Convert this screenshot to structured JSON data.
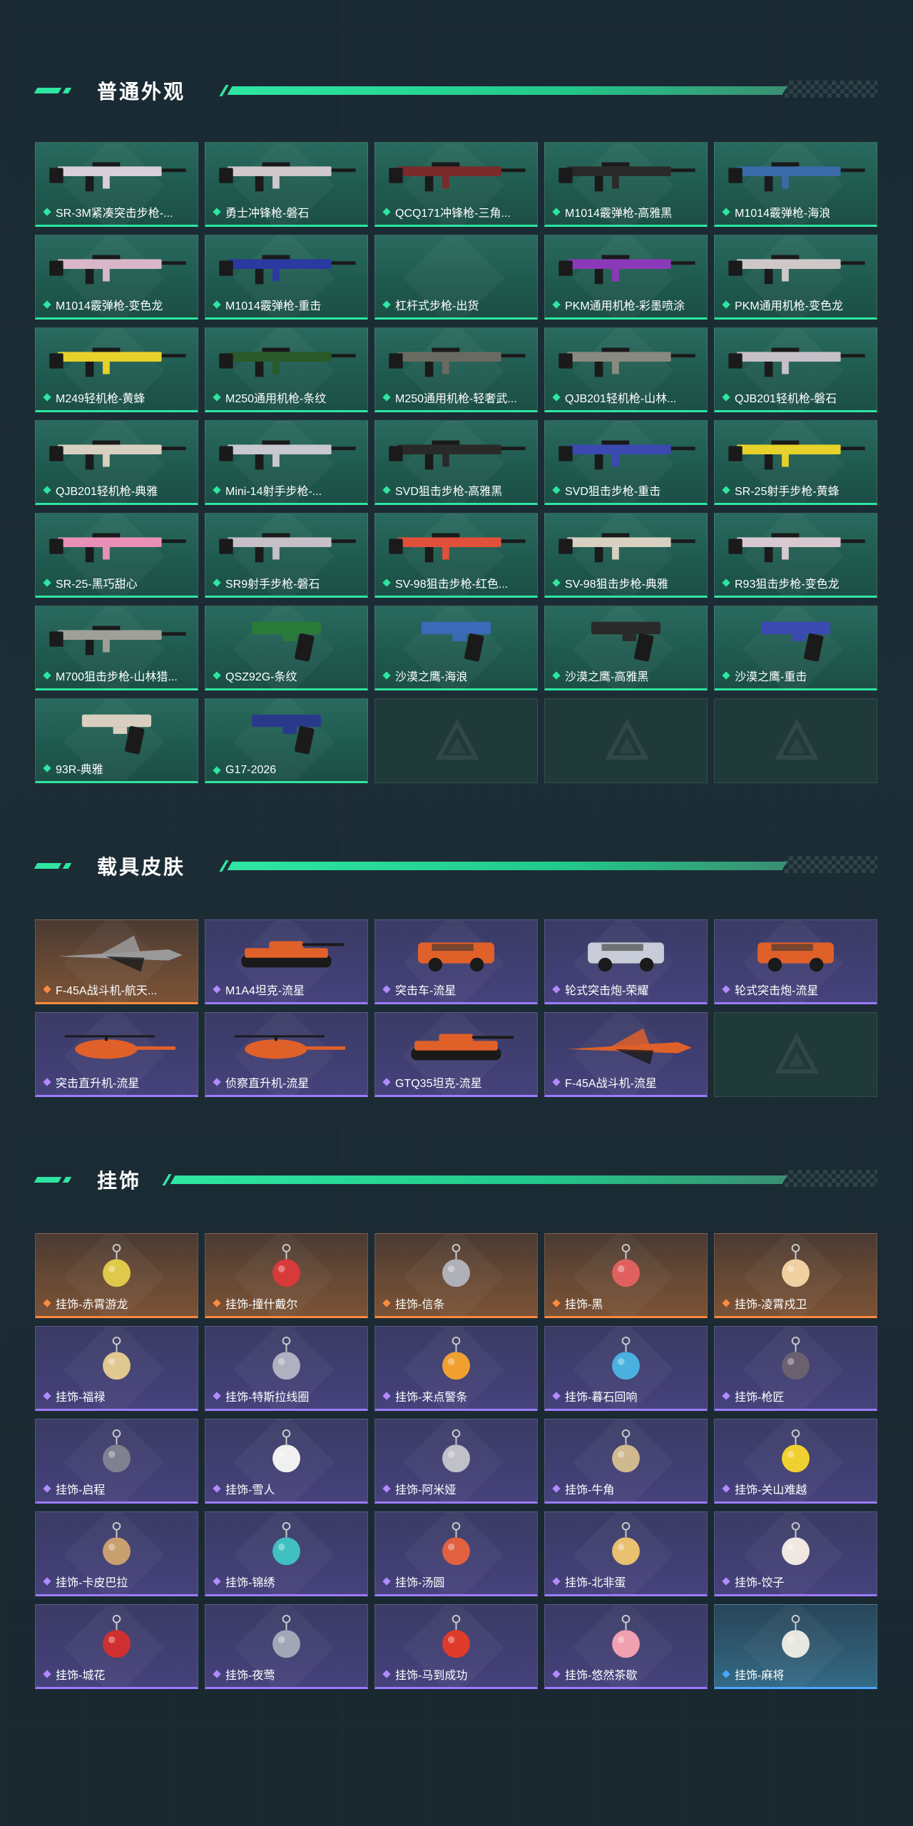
{
  "sections": [
    {
      "id": "weapons",
      "title": "普通外观",
      "items": [
        {
          "label": "SR-3M紧凑突击步枪-...",
          "rarity": "green",
          "color": "#d8d0d8",
          "kind": "gun"
        },
        {
          "label": "勇士冲锋枪-磐石",
          "rarity": "green",
          "color": "#d0c8cc",
          "kind": "gun"
        },
        {
          "label": "QCQ171冲锋枪-三角...",
          "rarity": "green",
          "color": "#7a2a2a",
          "kind": "gun"
        },
        {
          "label": "M1014霰弹枪-高雅黑",
          "rarity": "green",
          "color": "#2a2a2a",
          "kind": "gun"
        },
        {
          "label": "M1014霰弹枪-海浪",
          "rarity": "green",
          "color": "#3a6aa8",
          "kind": "gun"
        },
        {
          "label": "M1014霰弹枪-变色龙",
          "rarity": "green",
          "color": "#d8b8c8",
          "kind": "gun"
        },
        {
          "label": "M1014霰弹枪-重击",
          "rarity": "green",
          "color": "#2a3aa0",
          "kind": "gun"
        },
        {
          "label": "杠杆式步枪-出货",
          "rarity": "green",
          "color": "",
          "kind": "none"
        },
        {
          "label": "PKM通用机枪-彩墨喷涂",
          "rarity": "green",
          "color": "#8a3ab8",
          "kind": "gun"
        },
        {
          "label": "PKM通用机枪-变色龙",
          "rarity": "green",
          "color": "#d0c8c8",
          "kind": "gun"
        },
        {
          "label": "M249轻机枪-黄蜂",
          "rarity": "green",
          "color": "#e6d22a",
          "kind": "gun"
        },
        {
          "label": "M250通用机枪-条纹",
          "rarity": "green",
          "color": "#2a5a2a",
          "kind": "gun"
        },
        {
          "label": "M250通用机枪-轻奢武...",
          "rarity": "green",
          "color": "#6a6a60",
          "kind": "gun"
        },
        {
          "label": "QJB201轻机枪-山林...",
          "rarity": "green",
          "color": "#8a8a80",
          "kind": "gun"
        },
        {
          "label": "QJB201轻机枪-磐石",
          "rarity": "green",
          "color": "#c8c0c8",
          "kind": "gun"
        },
        {
          "label": "QJB201轻机枪-典雅",
          "rarity": "green",
          "color": "#d8d0c0",
          "kind": "gun"
        },
        {
          "label": "Mini-14射手步枪-...",
          "rarity": "green",
          "color": "#c8c8d0",
          "kind": "gun"
        },
        {
          "label": "SVD狙击步枪-高雅黑",
          "rarity": "green",
          "color": "#2a2a2a",
          "kind": "gun"
        },
        {
          "label": "SVD狙击步枪-重击",
          "rarity": "green",
          "color": "#3a4ab0",
          "kind": "gun"
        },
        {
          "label": "SR-25射手步枪-黄蜂",
          "rarity": "green",
          "color": "#e6d22a",
          "kind": "gun"
        },
        {
          "label": "SR-25-黑巧甜心",
          "rarity": "green",
          "color": "#e890b8",
          "kind": "gun"
        },
        {
          "label": "SR9射手步枪-磐石",
          "rarity": "green",
          "color": "#c8c0c8",
          "kind": "gun"
        },
        {
          "label": "SV-98狙击步枪-红色...",
          "rarity": "green",
          "color": "#e0503a",
          "kind": "gun"
        },
        {
          "label": "SV-98狙击步枪-典雅",
          "rarity": "green",
          "color": "#d8d0c0",
          "kind": "gun"
        },
        {
          "label": "R93狙击步枪-变色龙",
          "rarity": "green",
          "color": "#d8c8d0",
          "kind": "gun"
        },
        {
          "label": "M700狙击步枪-山林猎...",
          "rarity": "green",
          "color": "#a0a098",
          "kind": "gun"
        },
        {
          "label": "QSZ92G-条纹",
          "rarity": "green",
          "color": "#2a7a3a",
          "kind": "pistol"
        },
        {
          "label": "沙漠之鹰-海浪",
          "rarity": "green",
          "color": "#3a6ab8",
          "kind": "pistol"
        },
        {
          "label": "沙漠之鹰-高雅黑",
          "rarity": "green",
          "color": "#2a2a2a",
          "kind": "pistol"
        },
        {
          "label": "沙漠之鹰-重击",
          "rarity": "green",
          "color": "#3a4ab0",
          "kind": "pistol"
        },
        {
          "label": "93R-典雅",
          "rarity": "green",
          "color": "#d8cfc0",
          "kind": "pistol"
        },
        {
          "label": "G17-2026",
          "rarity": "green",
          "color": "#2a3a8a",
          "kind": "pistol"
        },
        {
          "label": "",
          "rarity": "empty",
          "color": "",
          "kind": "empty"
        },
        {
          "label": "",
          "rarity": "empty",
          "color": "",
          "kind": "empty"
        },
        {
          "label": "",
          "rarity": "empty",
          "color": "",
          "kind": "empty"
        }
      ]
    },
    {
      "id": "vehicles",
      "title": "载具皮肤",
      "items": [
        {
          "label": "F-45A战斗机-航天...",
          "rarity": "orange",
          "color": "#9a9a9a",
          "kind": "jet"
        },
        {
          "label": "M1A4坦克-流星",
          "rarity": "purple",
          "color": "#e0602a",
          "kind": "tank"
        },
        {
          "label": "突击车-流星",
          "rarity": "purple",
          "color": "#e0602a",
          "kind": "car"
        },
        {
          "label": "轮式突击炮-荣耀",
          "rarity": "purple",
          "color": "#c8ccd8",
          "kind": "car"
        },
        {
          "label": "轮式突击炮-流星",
          "rarity": "purple",
          "color": "#e0602a",
          "kind": "car"
        },
        {
          "label": "突击直升机-流星",
          "rarity": "purple",
          "color": "#e0602a",
          "kind": "heli"
        },
        {
          "label": "侦察直升机-流星",
          "rarity": "purple",
          "color": "#e0602a",
          "kind": "heli"
        },
        {
          "label": "GTQ35坦克-流星",
          "rarity": "purple",
          "color": "#e0602a",
          "kind": "tank"
        },
        {
          "label": "F-45A战斗机-流星",
          "rarity": "purple",
          "color": "#e0602a",
          "kind": "jet"
        },
        {
          "label": "",
          "rarity": "empty",
          "color": "",
          "kind": "empty"
        }
      ]
    },
    {
      "id": "charms",
      "title": "挂饰",
      "items": [
        {
          "label": "挂饰-赤霄游龙",
          "rarity": "orange",
          "color": "#e0c84a",
          "kind": "charm"
        },
        {
          "label": "挂饰-撞什戴尔",
          "rarity": "orange",
          "color": "#d83a3a",
          "kind": "charm"
        },
        {
          "label": "挂饰-信条",
          "rarity": "orange",
          "color": "#b0b0b8",
          "kind": "charm"
        },
        {
          "label": "挂饰-黑",
          "rarity": "orange",
          "color": "#e06060",
          "kind": "charm"
        },
        {
          "label": "挂饰-凌霄戍卫",
          "rarity": "orange",
          "color": "#f0d0a0",
          "kind": "charm"
        },
        {
          "label": "挂饰-福禄",
          "rarity": "purple",
          "color": "#e0c890",
          "kind": "charm"
        },
        {
          "label": "挂饰-特斯拉线圈",
          "rarity": "purple",
          "color": "#b0b0c0",
          "kind": "charm"
        },
        {
          "label": "挂饰-来点警条",
          "rarity": "purple",
          "color": "#f0a030",
          "kind": "charm"
        },
        {
          "label": "挂饰-暮石回响",
          "rarity": "purple",
          "color": "#4ab0e0",
          "kind": "charm"
        },
        {
          "label": "挂饰-枪匠",
          "rarity": "purple",
          "color": "#6a6070",
          "kind": "charm"
        },
        {
          "label": "挂饰-启程",
          "rarity": "purple",
          "color": "#808090",
          "kind": "charm"
        },
        {
          "label": "挂饰-雪人",
          "rarity": "purple",
          "color": "#f0f0f0",
          "kind": "charm"
        },
        {
          "label": "挂饰-阿米娅",
          "rarity": "purple",
          "color": "#c0c0c8",
          "kind": "charm"
        },
        {
          "label": "挂饰-牛角",
          "rarity": "purple",
          "color": "#d0b890",
          "kind": "charm"
        },
        {
          "label": "挂饰-关山难越",
          "rarity": "purple",
          "color": "#f0d030",
          "kind": "charm"
        },
        {
          "label": "挂饰-卡皮巴拉",
          "rarity": "purple",
          "color": "#c8a070",
          "kind": "charm"
        },
        {
          "label": "挂饰-锦绣",
          "rarity": "purple",
          "color": "#40c0c0",
          "kind": "charm"
        },
        {
          "label": "挂饰-汤圆",
          "rarity": "purple",
          "color": "#e06040",
          "kind": "charm"
        },
        {
          "label": "挂饰-北非蛋",
          "rarity": "purple",
          "color": "#e8c070",
          "kind": "charm"
        },
        {
          "label": "挂饰-饺子",
          "rarity": "purple",
          "color": "#f0e8e0",
          "kind": "charm"
        },
        {
          "label": "挂饰-城花",
          "rarity": "purple",
          "color": "#d03030",
          "kind": "charm"
        },
        {
          "label": "挂饰-夜莺",
          "rarity": "purple",
          "color": "#a0a8b8",
          "kind": "charm"
        },
        {
          "label": "挂饰-马到成功",
          "rarity": "purple",
          "color": "#e03a2a",
          "kind": "charm"
        },
        {
          "label": "挂饰-悠然茶歇",
          "rarity": "purple",
          "color": "#f0a0b0",
          "kind": "charm"
        },
        {
          "label": "挂饰-麻将",
          "rarity": "blue",
          "color": "#e8e8e0",
          "kind": "charm"
        }
      ]
    }
  ]
}
